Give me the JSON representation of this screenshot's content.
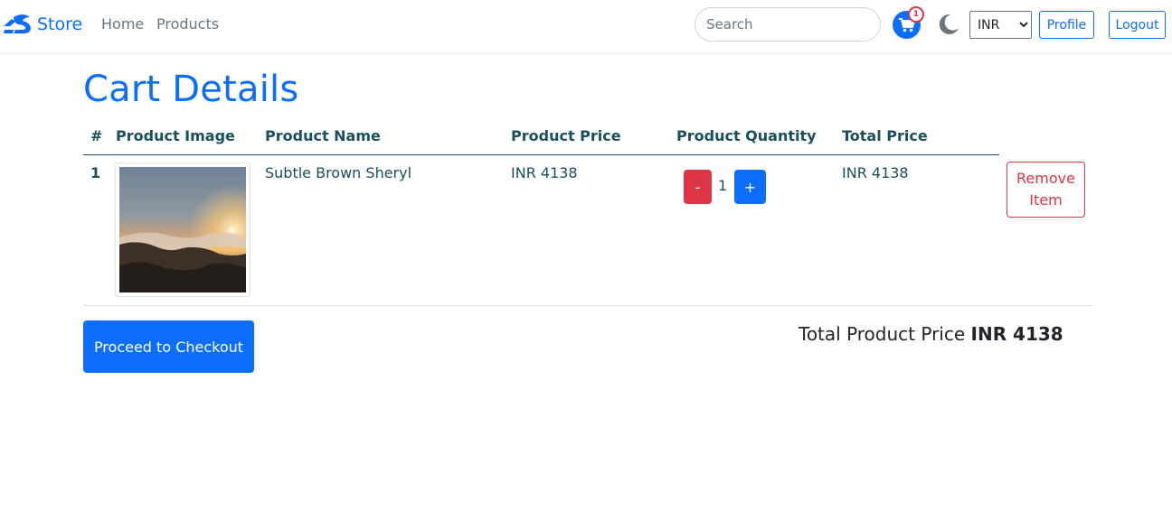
{
  "navbar": {
    "brand": "Store",
    "links": [
      "Home",
      "Products"
    ],
    "search_placeholder": "Search",
    "cart_count": "1",
    "currency_selected": "INR",
    "profile_label": "Profile",
    "logout_label": "Logout"
  },
  "page": {
    "title": "Cart Details"
  },
  "table": {
    "headers": [
      "#",
      "Product Image",
      "Product Name",
      "Product Price",
      "Product Quantity",
      "Total Price"
    ],
    "rows": [
      {
        "index": "1",
        "name": "Subtle Brown Sheryl",
        "price": "INR 4138",
        "quantity": "1",
        "total": "INR 4138",
        "minus_label": "-",
        "plus_label": "+",
        "remove_label": "Remove Item"
      }
    ]
  },
  "footer": {
    "checkout_label": "Proceed to Checkout",
    "total_label": "Total Product Price",
    "total_value": "INR 4138"
  },
  "colors": {
    "primary": "#0d6efd",
    "danger": "#dc3545",
    "heading_text": "#1a4f5c",
    "muted": "#6c757d"
  },
  "icons": {
    "brand": "store-logo-icon",
    "cart": "cart-icon",
    "theme": "moon-icon"
  }
}
